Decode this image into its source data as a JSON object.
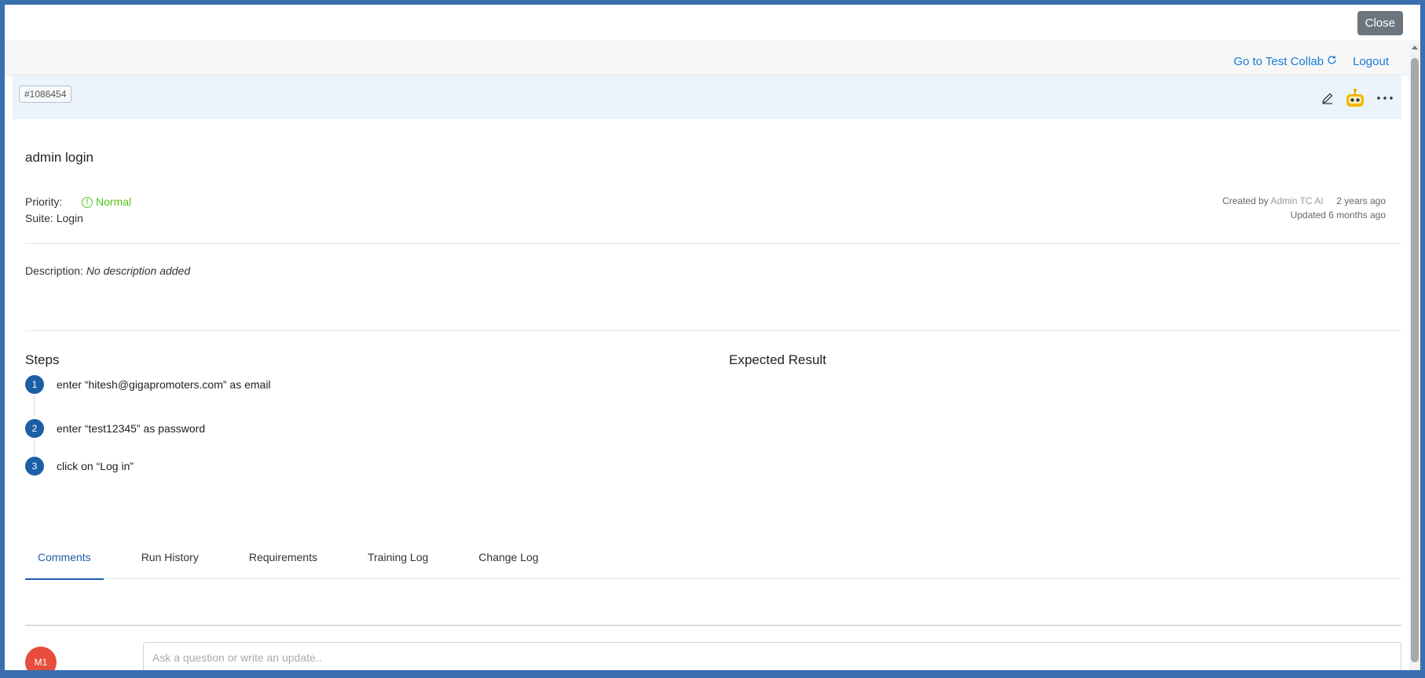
{
  "modal": {
    "close_label": "Close"
  },
  "topbar": {
    "go_to_label": "Go to Test Collab",
    "logout_label": "Logout"
  },
  "test_case": {
    "id": "#1086454",
    "title": "admin login",
    "priority_label": "Priority:",
    "priority_value": "Normal",
    "suite_text": "Suite: Login",
    "created_by_label": "Created by",
    "created_by_name": "Admin TC AI",
    "created_ago": "2 years ago",
    "updated_text": "Updated 6 months ago",
    "description_label": "Description:",
    "description_value": "No description added"
  },
  "steps_section": {
    "steps_title": "Steps",
    "expected_title": "Expected Result",
    "steps": [
      {
        "num": "1",
        "text": "enter “hitesh@gigapromoters.com” as email"
      },
      {
        "num": "2",
        "text": "enter “test12345” as password"
      },
      {
        "num": "3",
        "text": "click on “Log in”"
      }
    ]
  },
  "tabs": [
    {
      "label": "Comments",
      "active": true
    },
    {
      "label": "Run History"
    },
    {
      "label": "Requirements"
    },
    {
      "label": "Training Log"
    },
    {
      "label": "Change Log"
    }
  ],
  "comment": {
    "avatar_initials": "M1",
    "placeholder": "Ask a question or write an update.."
  },
  "colors": {
    "accent": "#1d5fa6",
    "link": "#1a7ad4",
    "priority_normal": "#52c41a",
    "avatar_bg": "#e74c3c"
  },
  "icons": {
    "edit": "pencil-icon",
    "ai": "robot-icon",
    "more": "more-icon",
    "refresh": "refresh-icon",
    "priority": "info-circle-icon"
  }
}
